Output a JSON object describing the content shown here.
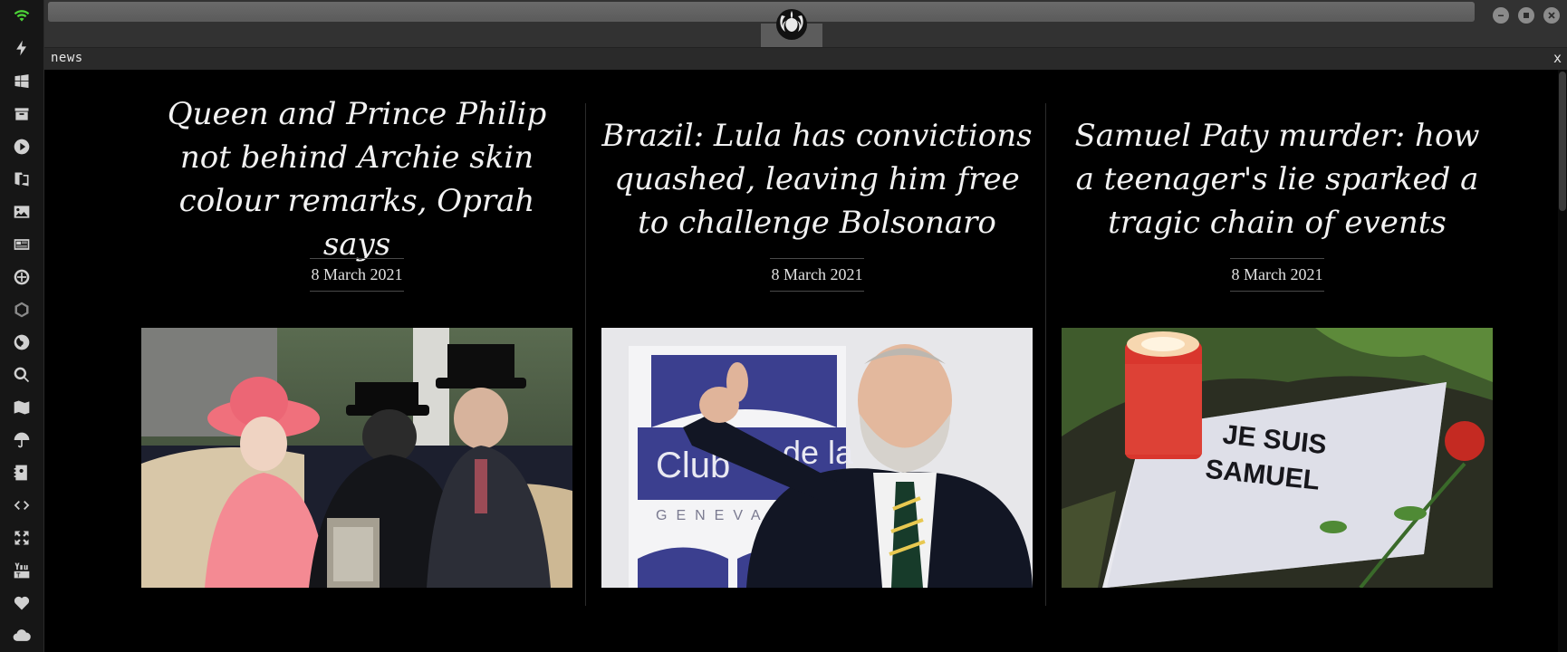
{
  "window": {
    "tab_label": "news",
    "tab_close": "x"
  },
  "dock": {
    "icons": [
      "wifi-icon",
      "lightning-icon",
      "windows-icon",
      "archive-icon",
      "play-icon",
      "translate-icon",
      "image-icon",
      "newspaper-icon",
      "settings-wheel-icon",
      "hexagon-icon",
      "globe-icon",
      "search-icon",
      "map-icon",
      "umbrella-icon",
      "contact-card-icon",
      "code-icon",
      "expand-icon",
      "youtube-icon",
      "heart-icon",
      "cloud-icon"
    ]
  },
  "colors": {
    "background": "#000000",
    "dock": "#161616",
    "topbar": "#323232",
    "wifi_accent": "#4cd137",
    "headline_text": "#f2f2f2"
  },
  "articles": [
    {
      "headline": "Queen and Prince Philip not behind Archie skin colour remarks, Oprah says",
      "date": "8 March 2021",
      "image_icon": "royal-carriage-photo"
    },
    {
      "headline": "Brazil: Lula has convictions quashed, leaving him free to challenge Bolsonaro",
      "date": "8 March 2021",
      "image_icon": "politician-thumbs-up-photo",
      "sign_text": "Club",
      "sign_text_2": "de la",
      "sign_text_3": "GENEVA"
    },
    {
      "headline": "Samuel Paty murder: how a teenager's lie sparked a tragic chain of events",
      "date": "8 March 2021",
      "image_icon": "memorial-candle-photo",
      "sign_line_1": "JE SUIS",
      "sign_line_2": "SAMUEL"
    }
  ]
}
